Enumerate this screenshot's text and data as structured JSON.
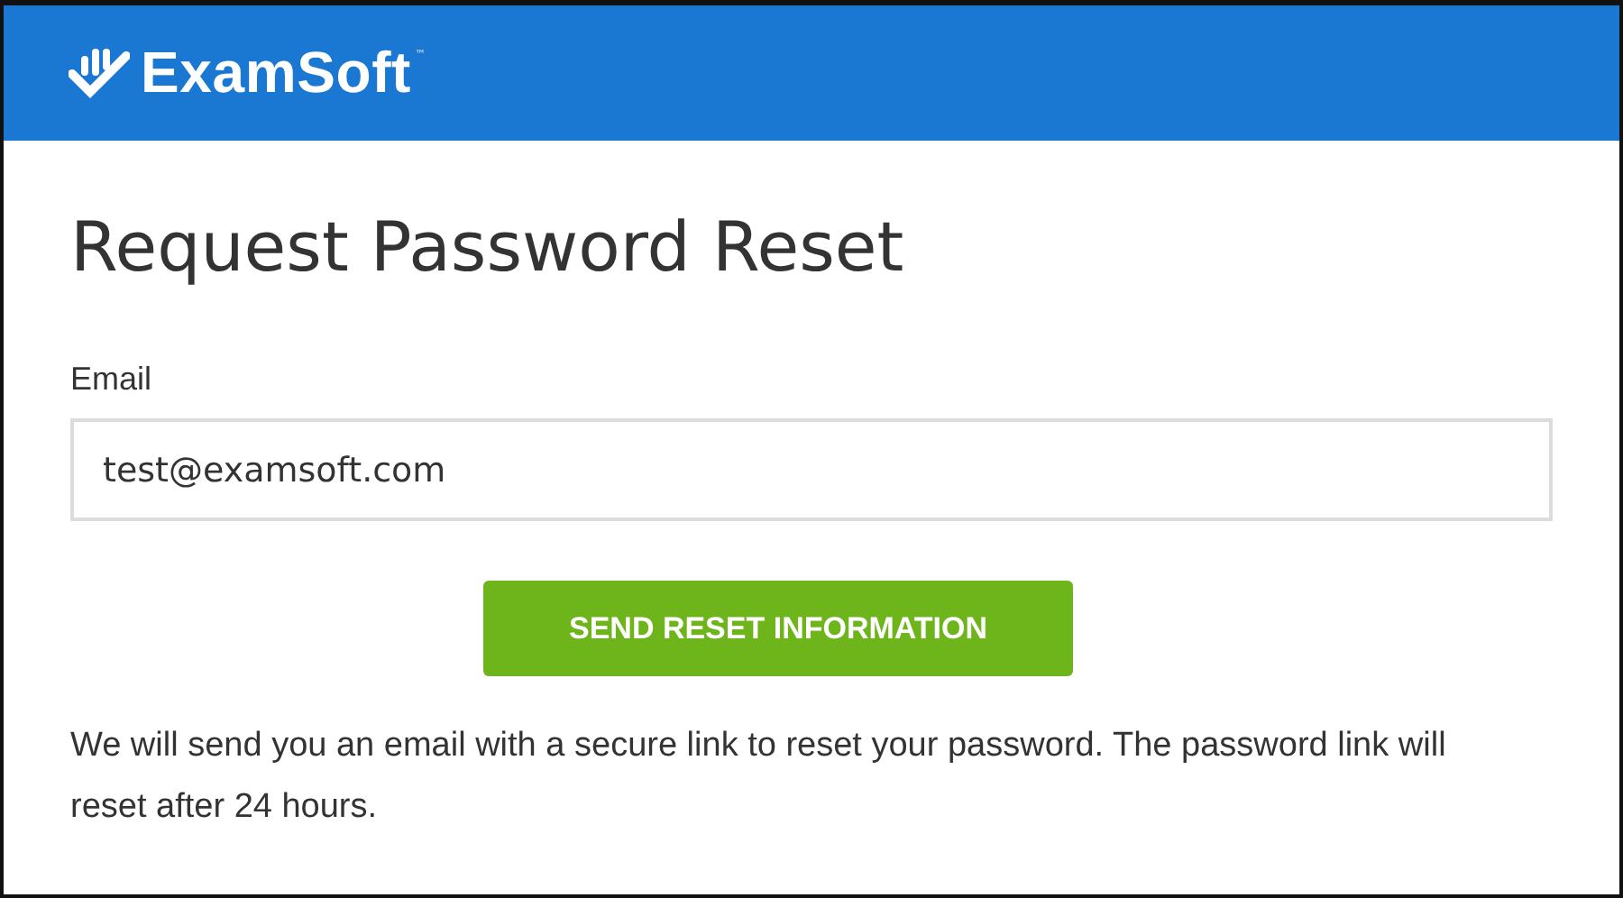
{
  "header": {
    "brand": "ExamSoft",
    "trademark": "™"
  },
  "title": "Request Password Reset",
  "email": {
    "label": "Email",
    "value": "test@examsoft.com"
  },
  "button": "SEND RESET INFORMATION",
  "note": "We will send you an email with a secure link to reset your password. The password link will reset after 24 hours."
}
